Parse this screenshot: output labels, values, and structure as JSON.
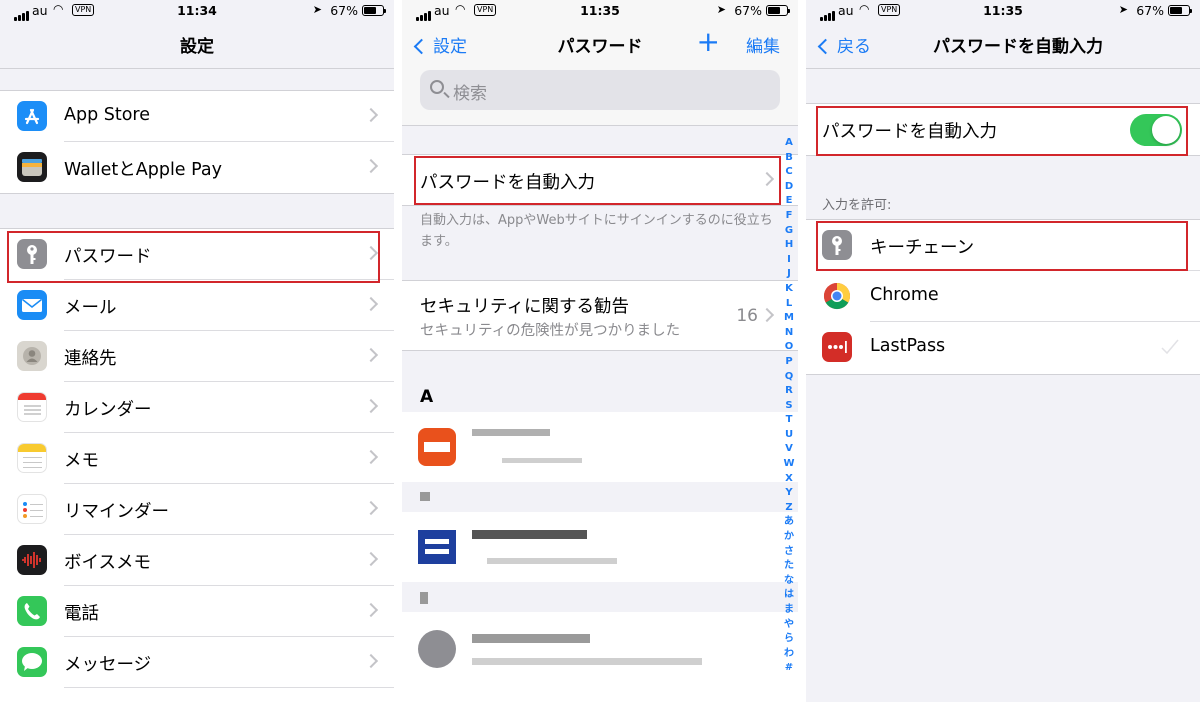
{
  "status": [
    {
      "carrier": "au",
      "vpn": "VPN",
      "time": "11:34",
      "battery": "67%"
    },
    {
      "carrier": "au",
      "vpn": "VPN",
      "time": "11:35",
      "battery": "67%"
    },
    {
      "carrier": "au",
      "vpn": "VPN",
      "time": "11:35",
      "battery": "67%"
    }
  ],
  "panel1": {
    "title": "設定",
    "items": [
      {
        "label": "App Store",
        "icon": "app-store-icon"
      },
      {
        "label": "WalletとApple Pay",
        "icon": "wallet-icon"
      },
      {
        "label": "パスワード",
        "icon": "key-icon"
      },
      {
        "label": "メール",
        "icon": "mail-icon"
      },
      {
        "label": "連絡先",
        "icon": "contacts-icon"
      },
      {
        "label": "カレンダー",
        "icon": "calendar-icon"
      },
      {
        "label": "メモ",
        "icon": "notes-icon"
      },
      {
        "label": "リマインダー",
        "icon": "reminders-icon"
      },
      {
        "label": "ボイスメモ",
        "icon": "voice-memos-icon"
      },
      {
        "label": "電話",
        "icon": "phone-icon"
      },
      {
        "label": "メッセージ",
        "icon": "messages-icon"
      }
    ]
  },
  "panel2": {
    "back": "設定",
    "title": "パスワード",
    "plus": "+",
    "edit": "編集",
    "search_placeholder": "検索",
    "autofill_label": "パスワードを自動入力",
    "autofill_note": "自動入力は、AppやWebサイトにサインインするのに役立ちます。",
    "security_title": "セキュリティに関する勧告",
    "security_sub": "セキュリティの危険性が見つかりました",
    "security_count": "16",
    "section_a": "A",
    "index": [
      "A",
      "B",
      "C",
      "D",
      "E",
      "F",
      "G",
      "H",
      "I",
      "J",
      "K",
      "L",
      "M",
      "N",
      "O",
      "P",
      "Q",
      "R",
      "S",
      "T",
      "U",
      "V",
      "W",
      "X",
      "Y",
      "Z",
      "あ",
      "か",
      "さ",
      "た",
      "な",
      "は",
      "ま",
      "や",
      "ら",
      "わ",
      "#"
    ]
  },
  "panel3": {
    "back": "戻る",
    "title": "パスワードを自動入力",
    "toggle_label": "パスワードを自動入力",
    "toggle_on": true,
    "allow_header": "入力を許可:",
    "providers": [
      {
        "label": "キーチェーン",
        "icon": "key-icon"
      },
      {
        "label": "Chrome",
        "icon": "chrome-icon"
      },
      {
        "label": "LastPass",
        "icon": "lastpass-icon"
      }
    ],
    "accent": "#34c759"
  }
}
